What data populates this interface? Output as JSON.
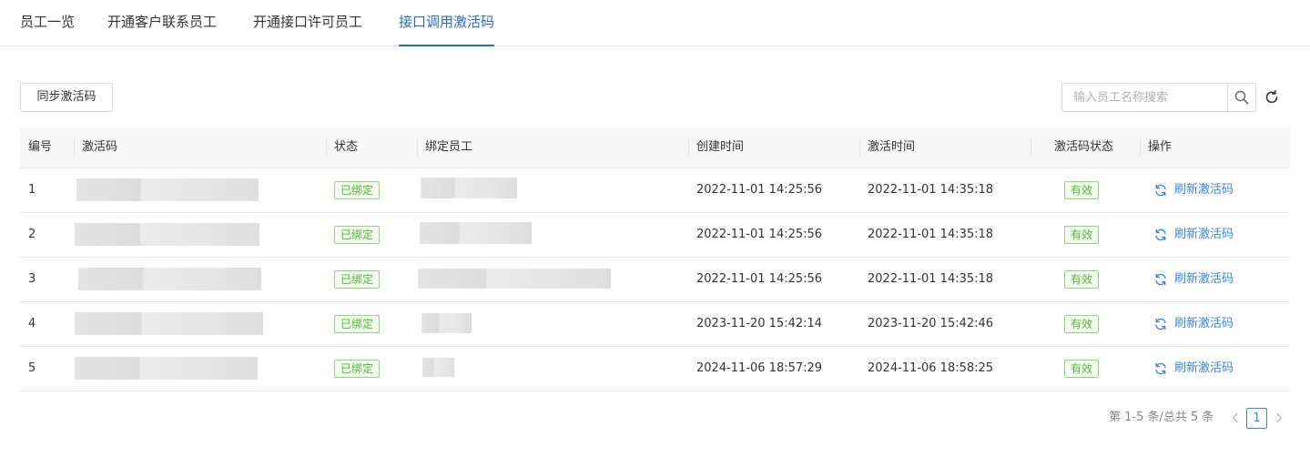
{
  "tabs": [
    {
      "label": "员工一览",
      "active": false
    },
    {
      "label": "开通客户联系员工",
      "active": false
    },
    {
      "label": "开通接口许可员工",
      "active": false
    },
    {
      "label": "接口调用激活码",
      "active": true
    }
  ],
  "toolbar": {
    "sync_label": "同步激活码",
    "search_placeholder": "输入员工名称搜索",
    "search_value": ""
  },
  "table": {
    "columns": [
      "编号",
      "激活码",
      "状态",
      "绑定员工",
      "创建时间",
      "激活时间",
      "激活码状态",
      "操作"
    ],
    "rows": [
      {
        "no": "1",
        "status": "已绑定",
        "created": "2022-11-01 14:25:56",
        "activated": "2022-11-01 14:35:18",
        "code_status": "有效",
        "action": "刷新激活码"
      },
      {
        "no": "2",
        "status": "已绑定",
        "created": "2022-11-01 14:25:56",
        "activated": "2022-11-01 14:35:18",
        "code_status": "有效",
        "action": "刷新激活码"
      },
      {
        "no": "3",
        "status": "已绑定",
        "created": "2022-11-01 14:25:56",
        "activated": "2022-11-01 14:35:18",
        "code_status": "有效",
        "action": "刷新激活码"
      },
      {
        "no": "4",
        "status": "已绑定",
        "created": "2023-11-20 15:42:14",
        "activated": "2023-11-20 15:42:46",
        "code_status": "有效",
        "action": "刷新激活码"
      },
      {
        "no": "5",
        "status": "已绑定",
        "created": "2024-11-06 18:57:29",
        "activated": "2024-11-06 18:58:25",
        "code_status": "有效",
        "action": "刷新激活码"
      }
    ]
  },
  "pagination": {
    "summary": "第 1-5 条/总共 5 条",
    "current_page": "1"
  },
  "colors": {
    "accent": "#2a6cc8",
    "link": "#3b86e3",
    "tag_green": "#52b83a"
  },
  "icons": {
    "search": "search-icon",
    "refresh": "refresh-icon",
    "row_refresh": "refresh-icon",
    "prev": "chevron-left-icon",
    "next": "chevron-right-icon"
  }
}
